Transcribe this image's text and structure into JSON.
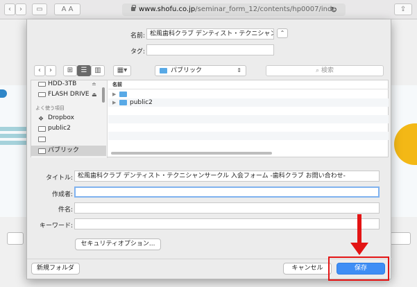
{
  "browser": {
    "url_host": "www.shofu.co.jp",
    "url_path": "/seminar_form_12/contents/hp0007/inde",
    "back_icon": "chevron-left-icon",
    "forward_icon": "chevron-right-icon",
    "sidebar_icon": "sidebar-icon",
    "reader_label": "A A",
    "reload_icon": "reload-icon",
    "share_icon": "share-icon"
  },
  "save_dialog": {
    "name_label": "名前:",
    "name_value": "松風歯科クラブ デンティスト・テクニシャン",
    "tags_label": "タグ:",
    "tags_value": "",
    "expand_icon": "chevron-up-icon",
    "location": "パブリック",
    "search_placeholder": "検索",
    "sidebar": {
      "devices": [
        "HDD-3TB",
        "FLASH DRIVE"
      ],
      "favorites_header": "よく使う項目",
      "favorites": [
        "Dropbox",
        "public2",
        "",
        "パブリック"
      ]
    },
    "file_list": {
      "column_header": "名前",
      "rows": [
        "",
        "public2"
      ]
    },
    "title_label": "タイトル:",
    "title_value": "松風歯科クラブ デンティスト・テクニシャンサークル 入会フォーム -歯科クラブ お問い合わせ-",
    "author_label": "作成者:",
    "author_value": "",
    "subject_label": "件名:",
    "subject_value": "",
    "keywords_label": "キーワード:",
    "keywords_value": "",
    "security_button": "セキュリティオプション...",
    "new_folder_button": "新規フォルダ",
    "cancel_button": "キャンセル",
    "save_button": "保存"
  },
  "colors": {
    "primary": "#3f8ef5",
    "annotation": "#e31414",
    "folder": "#58a9e6"
  }
}
